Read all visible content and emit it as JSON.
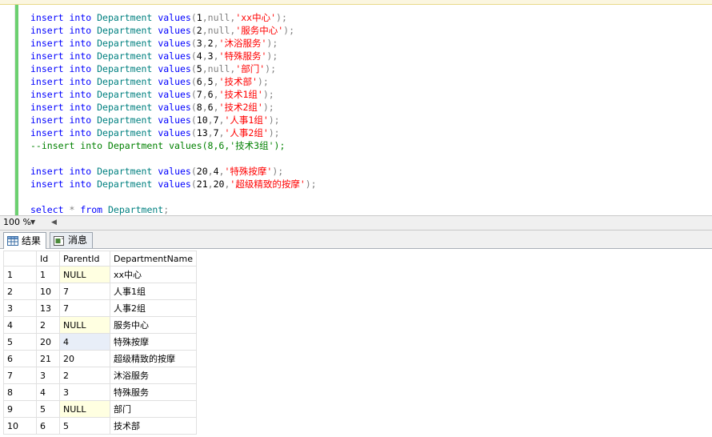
{
  "code_lines": [
    {
      "type": "insert",
      "id": "1",
      "parent": "null",
      "name": "'xx中心'"
    },
    {
      "type": "insert",
      "id": "2",
      "parent": "null",
      "name": "'服务中心'"
    },
    {
      "type": "insert",
      "id": "3",
      "parent": "2",
      "name": "'沐浴服务'"
    },
    {
      "type": "insert",
      "id": "4",
      "parent": "3",
      "name": "'特殊服务'"
    },
    {
      "type": "insert",
      "id": "5",
      "parent": "null",
      "name": "'部门'"
    },
    {
      "type": "insert",
      "id": "6",
      "parent": "5",
      "name": "'技术部'"
    },
    {
      "type": "insert",
      "id": "7",
      "parent": "6",
      "name": "'技术1组'"
    },
    {
      "type": "insert",
      "id": "8",
      "parent": "6",
      "name": "'技术2组'"
    },
    {
      "type": "insert",
      "id": "10",
      "parent": "7",
      "name": "'人事1组'"
    },
    {
      "type": "insert",
      "id": "13",
      "parent": "7",
      "name": "'人事2组'"
    },
    {
      "type": "comment",
      "text": "--insert into Department values(8,6,'技术3组');"
    },
    {
      "type": "blank"
    },
    {
      "type": "insert",
      "id": "20",
      "parent": "4",
      "name": "'特殊按摩'"
    },
    {
      "type": "insert",
      "id": "21",
      "parent": "20",
      "name": "'超级精致的按摩'"
    },
    {
      "type": "blank"
    },
    {
      "type": "select"
    }
  ],
  "keywords": {
    "insert": "insert",
    "into": "into",
    "table": "Department",
    "values": "values",
    "select": "select",
    "star": "*",
    "from": "from",
    "null": "null"
  },
  "zoom": "100 %",
  "tabs": [
    {
      "label": "结果",
      "icon": "grid-icon",
      "active": true
    },
    {
      "label": "消息",
      "icon": "message-icon",
      "active": false
    }
  ],
  "grid": {
    "columns": [
      "Id",
      "ParentId",
      "DepartmentName"
    ],
    "rows": [
      {
        "n": "1",
        "id": "1",
        "parent": "NULL",
        "name": "xx中心"
      },
      {
        "n": "2",
        "id": "10",
        "parent": "7",
        "name": "人事1组"
      },
      {
        "n": "3",
        "id": "13",
        "parent": "7",
        "name": "人事2组"
      },
      {
        "n": "4",
        "id": "2",
        "parent": "NULL",
        "name": "服务中心"
      },
      {
        "n": "5",
        "id": "20",
        "parent": "4",
        "name": "特殊按摩"
      },
      {
        "n": "6",
        "id": "21",
        "parent": "20",
        "name": "超级精致的按摩"
      },
      {
        "n": "7",
        "id": "3",
        "parent": "2",
        "name": "沐浴服务"
      },
      {
        "n": "8",
        "id": "4",
        "parent": "3",
        "name": "特殊服务"
      },
      {
        "n": "9",
        "id": "5",
        "parent": "NULL",
        "name": "部门"
      },
      {
        "n": "10",
        "id": "6",
        "parent": "5",
        "name": "技术部"
      }
    ]
  },
  "colors": {
    "keyword": "#0000ff",
    "object": "#008080",
    "string": "#ff0000",
    "comment": "#008000",
    "null_cell": "#ffffe1"
  }
}
